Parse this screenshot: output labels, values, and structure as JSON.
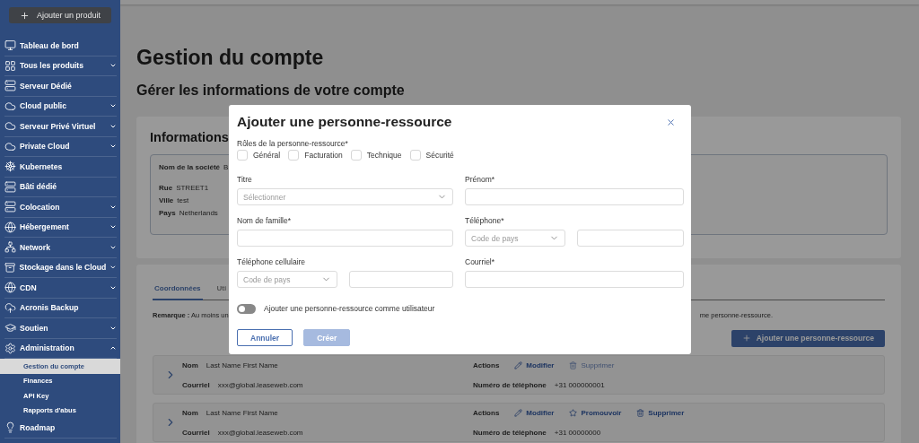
{
  "sidebar": {
    "add_button": "Ajouter un produit",
    "items": [
      {
        "label": "Tableau de bord",
        "kind": "link"
      },
      {
        "label": "Tous les produits",
        "kind": "menu",
        "expanded": false
      },
      {
        "label": "Serveur Dédié",
        "kind": "link"
      },
      {
        "label": "Cloud public",
        "kind": "menu",
        "expanded": false
      },
      {
        "label": "Serveur Privé Virtuel",
        "kind": "menu",
        "expanded": false
      },
      {
        "label": "Private Cloud",
        "kind": "menu",
        "expanded": false
      },
      {
        "label": "Kubernetes",
        "kind": "link"
      },
      {
        "label": "Bâti dédié",
        "kind": "link"
      },
      {
        "label": "Colocation",
        "kind": "menu",
        "expanded": false
      },
      {
        "label": "Hébergement",
        "kind": "menu",
        "expanded": false
      },
      {
        "label": "Network",
        "kind": "menu",
        "expanded": false
      },
      {
        "label": "Stockage dans le Cloud",
        "kind": "menu",
        "expanded": false
      },
      {
        "label": "CDN",
        "kind": "menu",
        "expanded": false
      },
      {
        "label": "Acronis Backup",
        "kind": "link"
      },
      {
        "label": "Soutien",
        "kind": "menu",
        "expanded": false
      },
      {
        "label": "Administration",
        "kind": "menu",
        "expanded": true,
        "children": [
          {
            "label": "Gestion du compte",
            "selected": true
          },
          {
            "label": "Finances",
            "selected": false
          },
          {
            "label": "API Key",
            "selected": false
          },
          {
            "label": "Rapports d'abus",
            "selected": false
          }
        ]
      },
      {
        "label": "Roadmap",
        "kind": "link"
      }
    ]
  },
  "page": {
    "title": "Gestion du compte",
    "subtitle": "Gérer les informations de votre compte"
  },
  "info_card": {
    "title": "Informations",
    "rows": [
      {
        "label": "Nom de la société",
        "value": "B"
      },
      {
        "label": "Rue",
        "value": "STREET1"
      },
      {
        "label": "Ville",
        "value": "test"
      },
      {
        "label": "Pays",
        "value": "Netherlands"
      }
    ]
  },
  "contacts_card": {
    "tabs": [
      {
        "label": "Coordonnées",
        "selected": true
      },
      {
        "label": "Uti",
        "selected": false
      }
    ],
    "note_left": "**Remarque :** Au moins un",
    "note_right": "me personne-ressource.",
    "add_button": "Ajouter une personne-ressource",
    "contacts": [
      {
        "name_label": "Nom",
        "name": "Last Name First Name",
        "email_label": "Courriel",
        "email": "xxx@global.leaseweb.com",
        "actions_label": "Actions",
        "phone_label": "Numéro de téléphone",
        "phone": "+31 000000001",
        "actions": [
          {
            "label": "Modifier",
            "kind": "edit",
            "disabled": false
          },
          {
            "label": "Supprimer",
            "kind": "delete",
            "disabled": true
          }
        ]
      },
      {
        "name_label": "Nom",
        "name": "Last Name First Name",
        "email_label": "Courriel",
        "email": "xxx@global.leaseweb.com",
        "actions_label": "Actions",
        "phone_label": "Numéro de téléphone",
        "phone": "+31 00000000",
        "actions": [
          {
            "label": "Modifier",
            "kind": "edit",
            "disabled": false
          },
          {
            "label": "Promouvoir",
            "kind": "promote",
            "disabled": false
          },
          {
            "label": "Supprimer",
            "kind": "delete",
            "disabled": false
          }
        ]
      }
    ]
  },
  "modal": {
    "title": "Ajouter une personne-ressource",
    "roles_label": "Rôles de la personne-ressource*",
    "roles": [
      {
        "label": "Général",
        "checked": false
      },
      {
        "label": "Facturation",
        "checked": false
      },
      {
        "label": "Technique",
        "checked": false
      },
      {
        "label": "Sécurité",
        "checked": false
      }
    ],
    "fields": [
      {
        "label": "Titre",
        "kind": "select",
        "placeholder": "Sélectionner"
      },
      {
        "label": "Prénom*",
        "kind": "text"
      },
      {
        "label": "Nom de famille*",
        "kind": "text"
      },
      {
        "label": "Téléphone*",
        "kind": "phone",
        "placeholder": "Code de pays"
      },
      {
        "label": "Téléphone cellulaire",
        "kind": "phone",
        "placeholder": "Code de pays"
      },
      {
        "label": "Courriel*",
        "kind": "text"
      }
    ],
    "toggle": {
      "label": "Ajouter une personne-ressource comme utilisateur",
      "on": false
    },
    "buttons": [
      {
        "label": "Annuler",
        "kind": "secondary",
        "disabled": false
      },
      {
        "label": "Créer",
        "kind": "primary",
        "disabled": true
      }
    ]
  }
}
